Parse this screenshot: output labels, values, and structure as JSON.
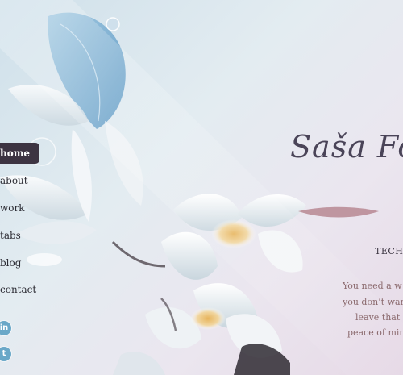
{
  "site": {
    "title": "Saša For"
  },
  "nav": {
    "items": [
      {
        "label": "home",
        "active": true
      },
      {
        "label": "about",
        "active": false
      },
      {
        "label": "work",
        "active": false
      },
      {
        "label": "tabs",
        "active": false
      },
      {
        "label": "blog",
        "active": false
      },
      {
        "label": "contact",
        "active": false
      }
    ],
    "social": [
      {
        "icon": "linkedin-icon",
        "glyph": "in"
      },
      {
        "icon": "twitter-icon",
        "glyph": "t"
      }
    ]
  },
  "content": {
    "heading": "TECH",
    "intro": [
      "You need a w",
      "you don’t wan",
      "leave that t",
      "peace of min"
    ]
  },
  "colors": {
    "active_nav_bg": "#3d3442",
    "title_text": "#4a4458",
    "intro_text": "#8b6a6e",
    "social_bg": "#6aa8c8"
  }
}
